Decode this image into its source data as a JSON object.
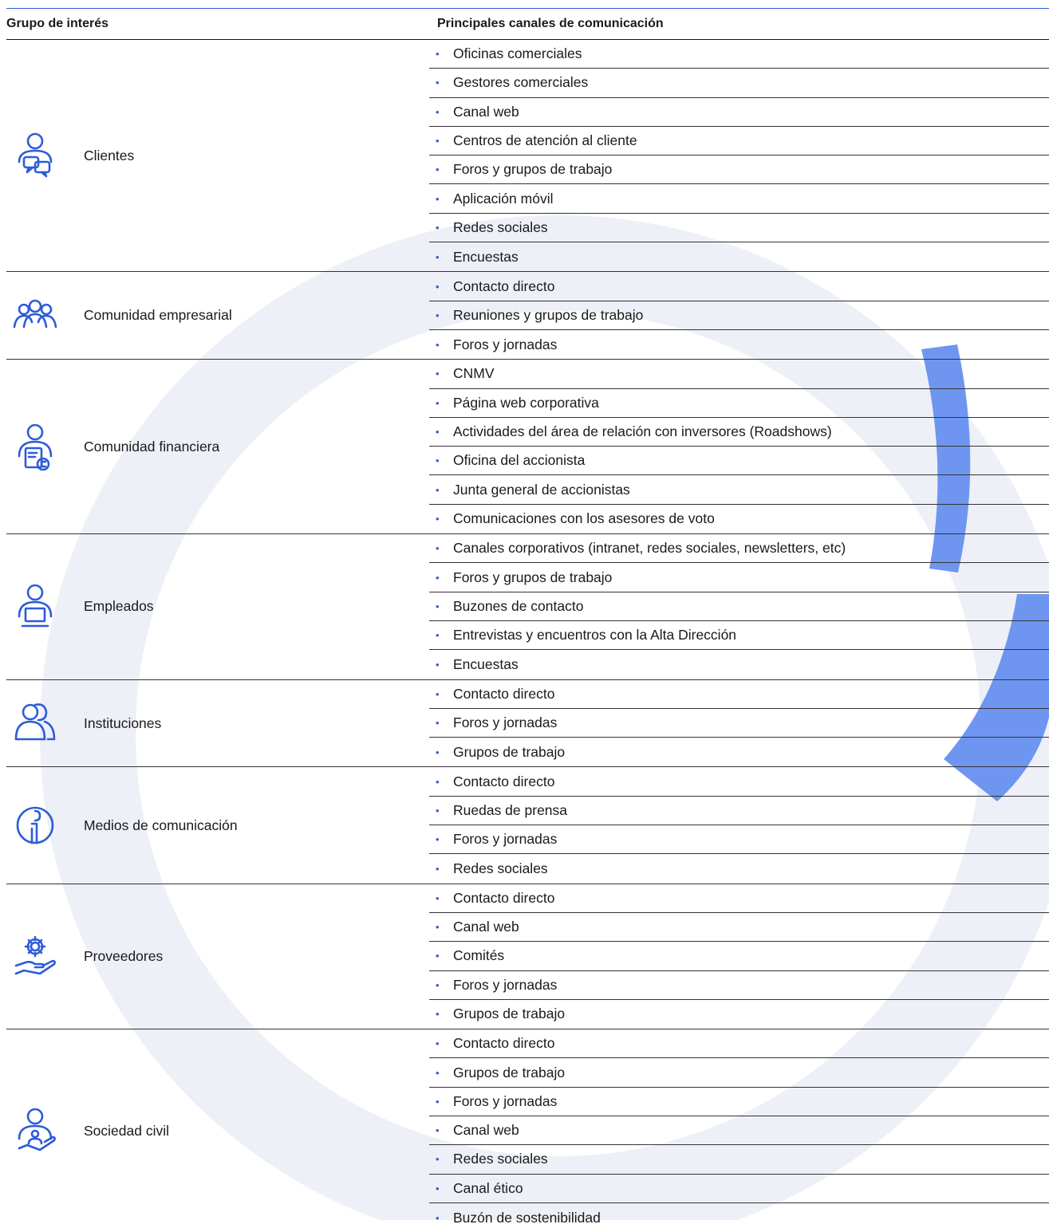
{
  "header": {
    "group_label": "Grupo de interés",
    "channels_label": "Principales canales de comunicación"
  },
  "colors": {
    "accent": "#2d5bd8",
    "art": "#6e96f0",
    "art_light": "#e9ecf6"
  },
  "groups": [
    {
      "name": "Clientes",
      "icon": "person-chat-icon",
      "channels": [
        "Oficinas comerciales",
        "Gestores comerciales",
        "Canal web",
        "Centros de atención al cliente",
        "Foros y grupos de trabajo",
        "Aplicación móvil",
        "Redes sociales",
        "Encuestas"
      ]
    },
    {
      "name": "Comunidad empresarial",
      "icon": "group-people-icon",
      "channels": [
        "Contacto directo",
        "Reuniones y grupos de trabajo",
        "Foros y jornadas"
      ]
    },
    {
      "name": "Comunidad financiera",
      "icon": "person-finance-icon",
      "channels": [
        "CNMV",
        "Página web corporativa",
        "Actividades del área de relación con inversores (Roadshows)",
        "Oficina del accionista",
        "Junta general de accionistas",
        "Comunicaciones con los asesores de voto"
      ]
    },
    {
      "name": "Empleados",
      "icon": "person-laptop-icon",
      "channels": [
        "Canales corporativos (intranet, redes sociales, newsletters, etc)",
        "Foros y grupos de trabajo",
        "Buzones de contacto",
        "Entrevistas y encuentros con la Alta Dirección",
        "Encuestas"
      ]
    },
    {
      "name": "Instituciones",
      "icon": "two-people-icon",
      "channels": [
        "Contacto directo",
        "Foros y jornadas",
        "Grupos de trabajo"
      ]
    },
    {
      "name": "Medios de comunicación",
      "icon": "info-media-icon",
      "channels": [
        "Contacto directo",
        "Ruedas de prensa",
        "Foros y jornadas",
        "Redes sociales"
      ]
    },
    {
      "name": "Proveedores",
      "icon": "gear-hand-icon",
      "channels": [
        "Contacto directo",
        "Canal web",
        "Comités",
        "Foros y jornadas",
        "Grupos de trabajo"
      ]
    },
    {
      "name": "Sociedad civil",
      "icon": "person-hand-icon",
      "channels": [
        "Contacto directo",
        "Grupos de trabajo",
        "Foros y jornadas",
        "Canal web",
        "Redes sociales",
        "Canal ético",
        "Buzón de sostenibilidad"
      ]
    }
  ]
}
